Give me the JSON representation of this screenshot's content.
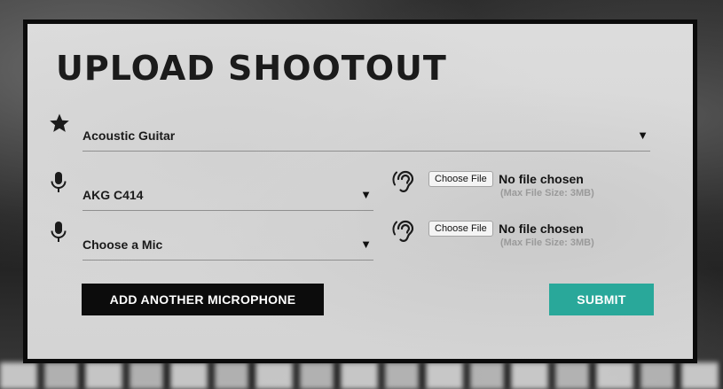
{
  "page": {
    "title": "UPLOAD SHOOTOUT"
  },
  "colors": {
    "panel_border": "#0b0b0b",
    "add_button": "#0c0c0c",
    "submit_button": "#29a89a"
  },
  "instrument": {
    "icon": "star-icon",
    "value": "Acoustic Guitar",
    "arrow": "▼"
  },
  "mics": [
    {
      "icon": "microphone-icon",
      "value": "AKG C414",
      "arrow": "▼",
      "file": {
        "icon": "ear-icon",
        "button": "Choose File",
        "status": "No file chosen",
        "hint": "(Max File Size: 3MB)"
      }
    },
    {
      "icon": "microphone-icon",
      "value": "Choose a Mic",
      "arrow": "▼",
      "file": {
        "icon": "ear-icon",
        "button": "Choose File",
        "status": "No file chosen",
        "hint": "(Max File Size: 3MB)"
      }
    }
  ],
  "actions": {
    "add_label": "ADD ANOTHER MICROPHONE",
    "submit_label": "SUBMIT"
  }
}
